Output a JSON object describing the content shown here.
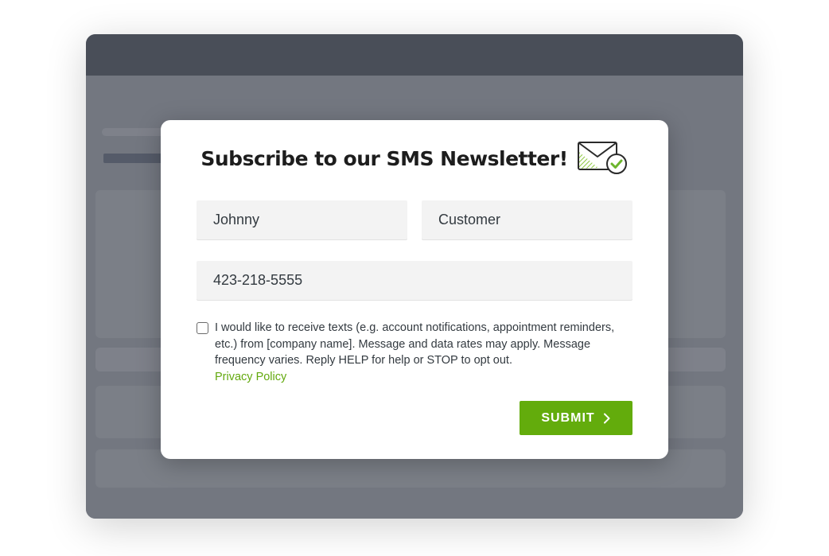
{
  "modal": {
    "title": "Subscribe to our SMS Newsletter!",
    "icon": "envelope-check-icon",
    "form": {
      "first_name": "Johnny",
      "last_name": "Customer",
      "phone": "423-218-5555",
      "consent_checked": false,
      "consent_text": "I would like to receive texts (e.g. account notifications, appointment reminders, etc.) from [company name]. Message and data rates may apply. Message frequency varies. Reply HELP for help or STOP to opt out.",
      "privacy_link": "Privacy Policy",
      "submit_label": "SUBMIT",
      "submit_icon": "chevron-right-icon"
    }
  },
  "colors": {
    "accent": "#63ac0c",
    "link": "#63a90e",
    "titlebar": "#494e58",
    "backdrop": "#737780"
  }
}
